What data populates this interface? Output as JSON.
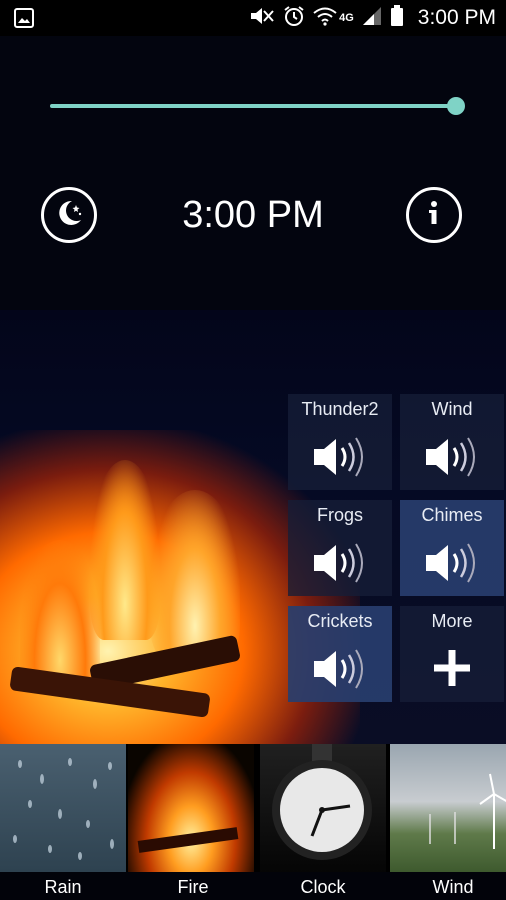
{
  "status_bar": {
    "time": "3:00 PM",
    "network": "4G"
  },
  "player": {
    "volume": 1.0,
    "sleep_timer_icon": "moon-stars-icon",
    "time_display": "3:00 PM",
    "info_icon": "info-icon"
  },
  "sound_tiles": [
    {
      "label": "Thunder2",
      "icon": "speaker-icon",
      "active": false
    },
    {
      "label": "Wind",
      "icon": "speaker-icon",
      "active": false
    },
    {
      "label": "Frogs",
      "icon": "speaker-icon",
      "active": false
    },
    {
      "label": "Chimes",
      "icon": "speaker-icon",
      "active": true
    },
    {
      "label": "Crickets",
      "icon": "speaker-icon",
      "active": true
    },
    {
      "label": "More",
      "icon": "plus-icon",
      "active": false
    }
  ],
  "scenes": [
    {
      "label": "Rain"
    },
    {
      "label": "Fire"
    },
    {
      "label": "Clock"
    },
    {
      "label": "Wind"
    }
  ],
  "colors": {
    "accent": "#7fd3c6",
    "background": "#03050f",
    "tile": "#161e37",
    "tile_active": "#283e6e"
  }
}
